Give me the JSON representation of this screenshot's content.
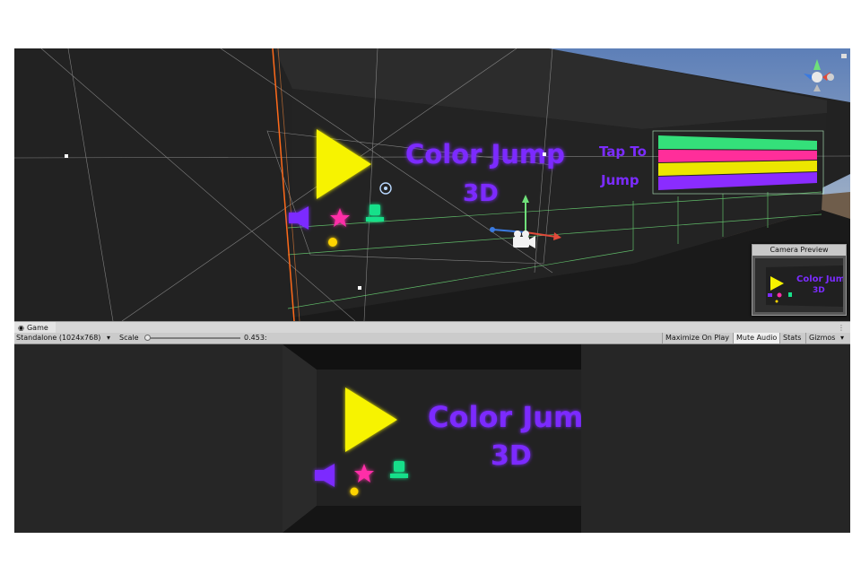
{
  "scene": {
    "title_line1": "Color Jump",
    "title_line2": "3D",
    "tap_line1": "Tap To",
    "tap_line2": "Jump"
  },
  "camera_preview": {
    "title": "Camera Preview",
    "title_line1": "Color Jump",
    "title_line2": "3D"
  },
  "game_panel": {
    "tab_label": "Game",
    "resolution": "Standalone (1024x768)",
    "scale_label": "Scale",
    "scale_value": "0.453:",
    "maximize_label": "Maximize On Play",
    "mute_label": "Mute Audio",
    "stats_label": "Stats",
    "gizmos_label": "Gizmos"
  },
  "game_view": {
    "title_line1": "Color Jump",
    "title_line2": "3D"
  },
  "colors": {
    "play": "#f7f300",
    "neon_purple": "#7b2cff",
    "star_pink": "#ff2ea8",
    "podium_green": "#19e08a",
    "coin_yellow": "#ffd400",
    "bar_green": "#34e07a",
    "bar_pink": "#ff2e9a",
    "bar_yellow": "#ece600",
    "bar_purple": "#8a2cff"
  }
}
